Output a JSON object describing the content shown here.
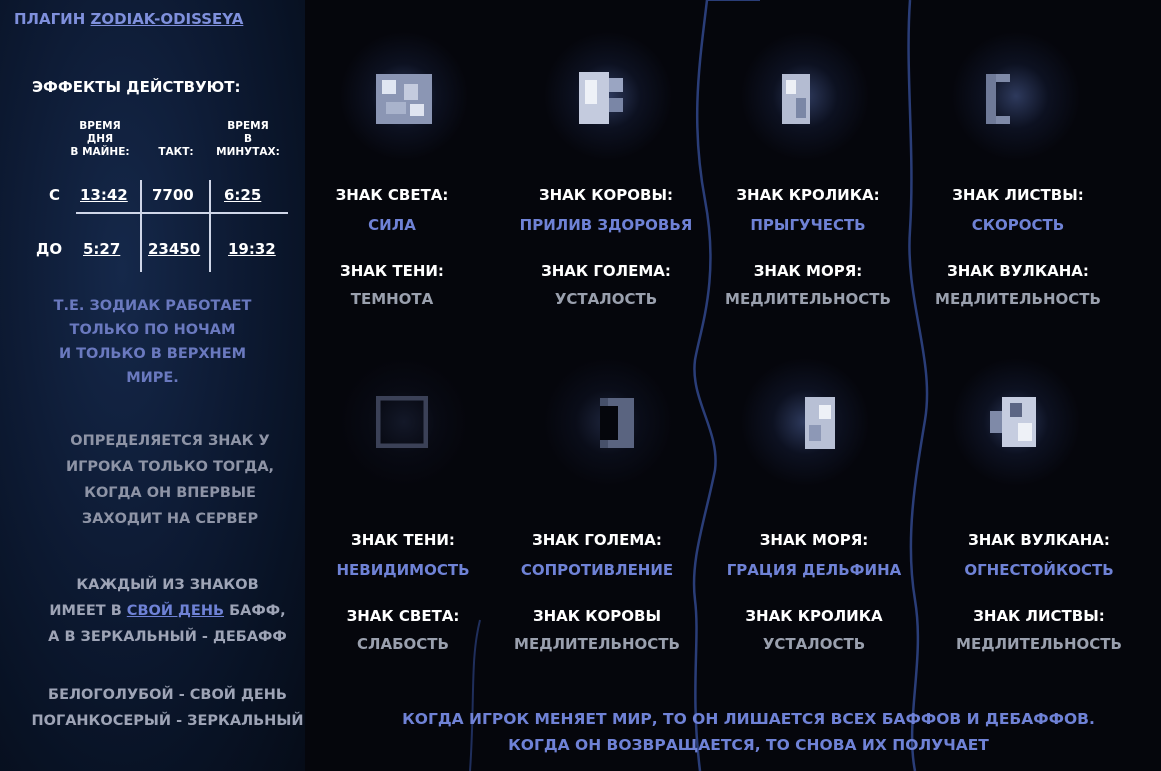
{
  "sidebar": {
    "title_prefix": "ПЛАГИН",
    "title_plugin": "ZODIAK-ODISSEYA",
    "effects_heading": "ЭФФЕКТЫ ДЕЙСТВУЮТ:",
    "table": {
      "headers": [
        [
          "ВРЕМЯ",
          "ДНЯ",
          "В МАЙНЕ:"
        ],
        [
          "ТАКТ:"
        ],
        [
          "ВРЕМЯ",
          "В",
          "МИНУТАХ:"
        ]
      ],
      "rows": [
        {
          "label": "С",
          "cells": [
            "13:42",
            "7700",
            "6:25"
          ]
        },
        {
          "label": "ДО",
          "cells": [
            "5:27",
            "23450",
            "19:32"
          ]
        }
      ]
    },
    "note_night": [
      "Т.Е. ЗОДИАК РАБОТАЕТ",
      "ТОЛЬКО ПО НОЧАМ",
      "И ТОЛЬКО В ВЕРХНЕМ",
      "МИРЕ."
    ],
    "note_first": [
      "ОПРЕДЕЛЯЕТСЯ ЗНАК У",
      "ИГРОКА ТОЛЬКО ТОГДА,",
      "КОГДА ОН ВПЕРВЫЕ",
      "ЗАХОДИТ НА СЕРВЕР"
    ],
    "note_buff": {
      "line1": "КАЖДЫЙ ИЗ ЗНАКОВ",
      "line2_pre": "ИМЕЕТ В ",
      "line2_link": "СВОЙ ДЕНЬ",
      "line2_post": " БАФФ,",
      "line3": "А В ЗЕРКАЛЬНЫЙ - ДЕБАФФ"
    },
    "legend": [
      "БЕЛОГОЛУБОЙ - СВОЙ ДЕНЬ",
      "ПОГАНКОСЕРЫЙ - ЗЕРКАЛЬНЫЙ"
    ]
  },
  "signs_top": [
    {
      "sign": "ЗНАК СВЕТА:",
      "buff": "СИЛА",
      "mirror_sign": "ЗНАК ТЕНИ:",
      "debuff": "ТЕМНОТА",
      "icon": "light-sign-icon"
    },
    {
      "sign": "ЗНАК КОРОВЫ:",
      "buff": "ПРИЛИВ ЗДОРОВЬЯ",
      "mirror_sign": "ЗНАК ГОЛЕМА:",
      "debuff": "УСТАЛОСТЬ",
      "icon": "cow-sign-icon"
    },
    {
      "sign": "ЗНАК КРОЛИКА:",
      "buff": "ПРЫГУЧЕСТЬ",
      "mirror_sign": "ЗНАК МОРЯ:",
      "debuff": "МЕДЛИТЕЛЬНОСТЬ",
      "icon": "rabbit-sign-icon"
    },
    {
      "sign": "ЗНАК ЛИСТВЫ:",
      "buff": "СКОРОСТЬ",
      "mirror_sign": "ЗНАК ВУЛКАНА:",
      "debuff": "МЕДЛИТЕЛЬНОСТЬ",
      "icon": "foliage-sign-icon"
    }
  ],
  "signs_bottom": [
    {
      "sign": "ЗНАК ТЕНИ:",
      "buff": "НЕВИДИМОСТЬ",
      "mirror_sign": "ЗНАК СВЕТА:",
      "debuff": "СЛАБОСТЬ",
      "icon": "shadow-sign-icon"
    },
    {
      "sign": "ЗНАК ГОЛЕМА:",
      "buff": "СОПРОТИВЛЕНИЕ",
      "mirror_sign": "ЗНАК КОРОВЫ",
      "debuff": "МЕДЛИТЕЛЬНОСТЬ",
      "icon": "golem-sign-icon"
    },
    {
      "sign": "ЗНАК МОРЯ:",
      "buff": "ГРАЦИЯ ДЕЛЬФИНА",
      "mirror_sign": "ЗНАК КРОЛИКА",
      "debuff": "УСТАЛОСТЬ",
      "icon": "sea-sign-icon"
    },
    {
      "sign": "ЗНАК ВУЛКАНА:",
      "buff": "ОГНЕСТОЙКОСТЬ",
      "mirror_sign": "ЗНАК ЛИСТВЫ:",
      "debuff": "МЕДЛИТЕЛЬНОСТЬ",
      "icon": "volcano-sign-icon"
    }
  ],
  "footer": [
    "КОГДА ИГРОК МЕНЯЕТ МИР, ТО ОН ЛИШАЕТСЯ ВСЕХ БАФФОВ И ДЕБАФФОВ.",
    "КОГДА ОН ВОЗВРАЩАЕТСЯ, ТО СНОВА ИХ ПОЛУЧАЕТ"
  ],
  "colors": {
    "buff_blue": "#6f82d6",
    "debuff_grey": "#9aa0ae",
    "sidebar_bg": "#0d1a33",
    "page_bg": "#05060c"
  }
}
